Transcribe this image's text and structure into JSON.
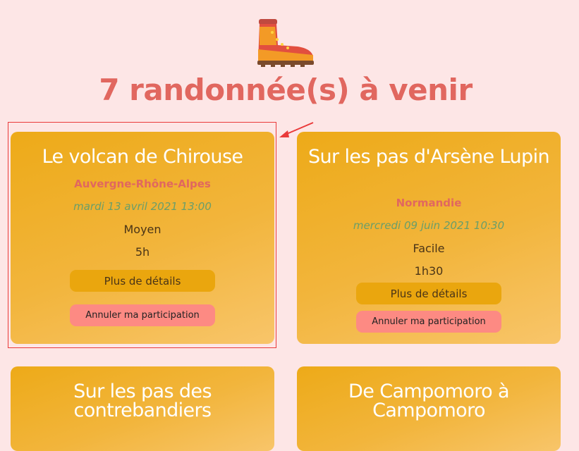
{
  "header": {
    "logo_icon": "hiking-boot-icon",
    "title": "7 randonnée(s) à venir"
  },
  "hikes": [
    {
      "title": "Le volcan de Chirouse",
      "region": "Auvergne-Rhône-Alpes",
      "date": "mardi 13 avril 2021 13:00",
      "level": "Moyen",
      "duration": "5h",
      "details_label": "Plus de détails",
      "cancel_label": "Annuler ma participation"
    },
    {
      "title": "Sur les pas d'Arsène Lupin",
      "region": "Normandie",
      "date": "mercredi 09 juin 2021 10:30",
      "level": "Facile",
      "duration": "1h30",
      "details_label": "Plus de détails",
      "cancel_label": "Annuler ma participation"
    },
    {
      "title": "Sur les pas des contrebandiers"
    },
    {
      "title": "De Campomoro à Campomoro"
    }
  ],
  "colors": {
    "background": "#fde6e6",
    "accent": "#e1675f",
    "card": "#f2b53c",
    "cancel_button": "#fd8a83",
    "annotation": "#ea3a3a"
  }
}
